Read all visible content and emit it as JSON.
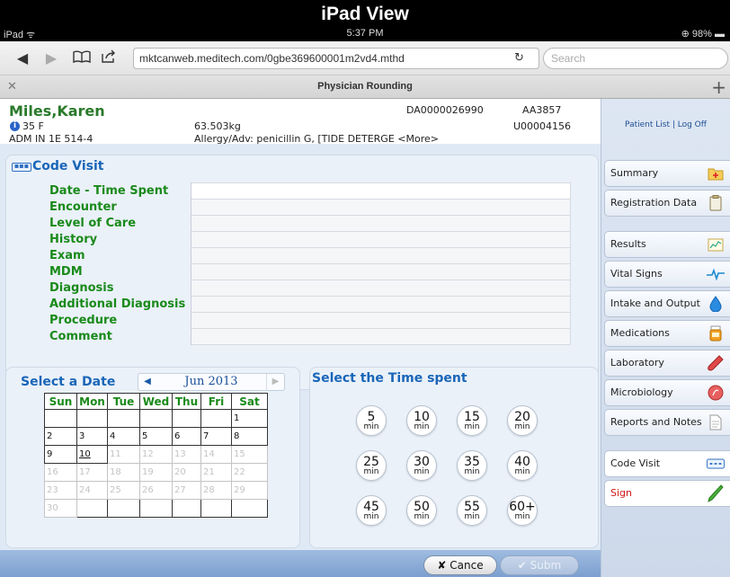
{
  "banner_title": "iPad View",
  "status": {
    "device": "iPad ᯤ",
    "time": "5:37 PM",
    "battery": "⊕ 98% ▬"
  },
  "browser": {
    "url": "mktcanweb.meditech.com/0gbe369600001m2vd4.mthd",
    "search_placeholder": "Search",
    "tab_title": "Physician Rounding"
  },
  "patient": {
    "name": "Miles,Karen",
    "age_sex": "35 F",
    "admission": "ADM IN 1E 514-4",
    "weight": "63.503kg",
    "allergy": "Allergy/Adv: penicillin G, [TIDE DETERGE <More>",
    "account": "DA0000026990",
    "mrn": "AA3857",
    "unit_number": "U00004156"
  },
  "header_links": "Patient List  |  Log Off",
  "nav": {
    "summary": "Summary",
    "registration": "Registration Data",
    "results": "Results",
    "vitals": "Vital Signs",
    "intake": "Intake and Output",
    "medications": "Medications",
    "laboratory": "Laboratory",
    "microbiology": "Microbiology",
    "reports": "Reports and Notes",
    "code_visit": "Code Visit",
    "sign": "Sign"
  },
  "code_visit": {
    "title": "Code Visit",
    "fields": [
      "Date - Time Spent",
      "Encounter",
      "Level of Care",
      "History",
      "Exam",
      "MDM",
      "Diagnosis",
      "Additional Diagnosis",
      "Procedure",
      "Comment"
    ]
  },
  "calendar": {
    "label": "Select a Date",
    "month": "Jun 2013",
    "days": [
      "Sun",
      "Mon",
      "Tue",
      "Wed",
      "Thu",
      "Fri",
      "Sat"
    ],
    "weeks": [
      [
        "",
        "",
        "",
        "",
        "",
        "",
        "1"
      ],
      [
        "2",
        "3",
        "4",
        "5",
        "6",
        "7",
        "8"
      ],
      [
        "9",
        "10",
        "11",
        "12",
        "13",
        "14",
        "15"
      ],
      [
        "16",
        "17",
        "18",
        "19",
        "20",
        "21",
        "22"
      ],
      [
        "23",
        "24",
        "25",
        "26",
        "27",
        "28",
        "29"
      ],
      [
        "30",
        "",
        "",
        "",
        "",
        "",
        ""
      ]
    ],
    "today": "10",
    "last_enabled_day": 10
  },
  "time_spent": {
    "label": "Select the Time spent",
    "unit": "min",
    "options": [
      "5",
      "10",
      "15",
      "20",
      "25",
      "30",
      "35",
      "40",
      "45",
      "50",
      "55",
      "60+"
    ]
  },
  "buttons": {
    "cancel": "✘ Cance",
    "submit": "✔ Subm"
  },
  "colors": {
    "header_blue": "#1a66b8",
    "label_green": "#1a8a1a",
    "sign_red": "#d01818"
  }
}
